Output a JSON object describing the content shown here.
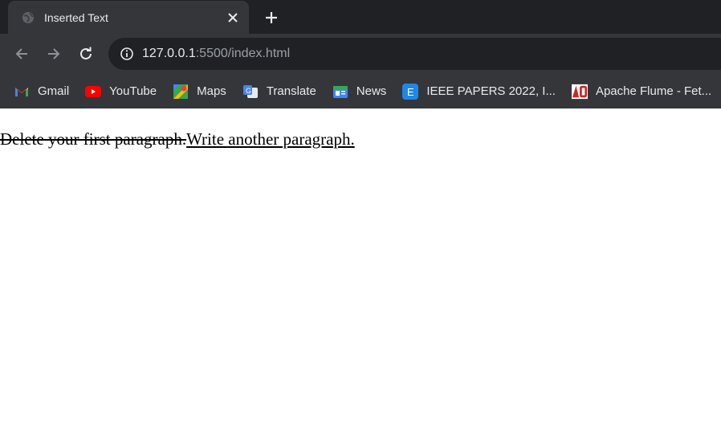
{
  "tab": {
    "title": "Inserted Text",
    "favicon": "globe-icon"
  },
  "toolbar": {
    "url_host": "127.0.0.1",
    "url_rest": ":5500/index.html"
  },
  "bookmarks": [
    {
      "label": "Gmail",
      "icon": "gmail-icon"
    },
    {
      "label": "YouTube",
      "icon": "youtube-icon"
    },
    {
      "label": "Maps",
      "icon": "maps-icon"
    },
    {
      "label": "Translate",
      "icon": "translate-icon"
    },
    {
      "label": "News",
      "icon": "news-icon"
    },
    {
      "label": "IEEE PAPERS 2022, I...",
      "icon": "ieee-icon"
    },
    {
      "label": "Apache Flume - Fet...",
      "icon": "apache-icon"
    }
  ],
  "page": {
    "deleted_text": "Delete your first paragraph.",
    "inserted_text": "Write another paragraph."
  },
  "colors": {
    "tabstrip": "#202124",
    "toolbar": "#35363a",
    "text": "#e8eaed"
  }
}
